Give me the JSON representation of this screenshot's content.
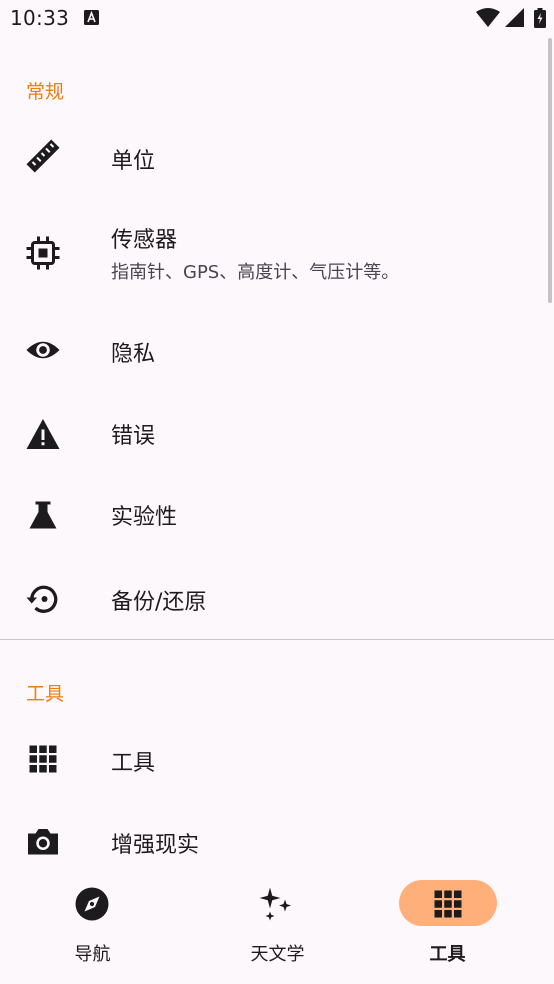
{
  "status_bar": {
    "time": "10:33"
  },
  "sections": [
    {
      "header": "常规",
      "items": [
        {
          "title": "单位",
          "icon": "ruler-icon"
        },
        {
          "title": "传感器",
          "subtitle": "指南针、GPS、高度计、气压计等。",
          "icon": "chip-icon"
        },
        {
          "title": "隐私",
          "icon": "eye-icon"
        },
        {
          "title": "错误",
          "icon": "warning-icon"
        },
        {
          "title": "实验性",
          "icon": "flask-icon"
        },
        {
          "title": "备份/还原",
          "icon": "restore-icon"
        }
      ]
    },
    {
      "header": "工具",
      "items": [
        {
          "title": "工具",
          "icon": "grid-icon"
        },
        {
          "title": "增强现实",
          "icon": "camera-icon"
        }
      ]
    }
  ],
  "bottom_nav": [
    {
      "label": "导航",
      "icon": "compass-icon",
      "active": false
    },
    {
      "label": "天文学",
      "icon": "sparkles-icon",
      "active": false
    },
    {
      "label": "工具",
      "icon": "grid-icon",
      "active": true
    }
  ],
  "colors": {
    "accent": "#f07c12",
    "background": "#fdf8fc",
    "active_pill": "#ffb07a"
  }
}
